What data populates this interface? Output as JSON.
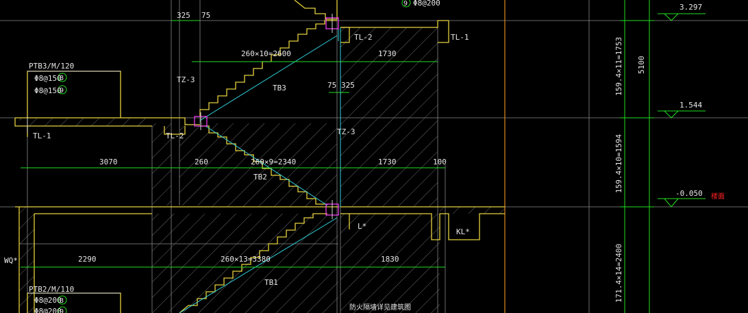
{
  "labels": {
    "tl2_top": "TL-2",
    "tl1_top": "TL-1",
    "tl1_left": "TL-1",
    "tl2_mid": "TL-2",
    "tz3_left": "TZ-3",
    "tz3_mid": "TZ-3",
    "tb3": "TB3",
    "tb2": "TB2",
    "tb1": "TB1",
    "l_beam": "L*",
    "kl_beam": "KL*",
    "wq": "WQ*",
    "ptb3_title": "PTB3/M/120",
    "ptb3_rebar1": "Φ8@150",
    "ptb3_rebar1_tag": "8",
    "ptb3_rebar2": "Φ8@150",
    "ptb3_rebar2_tag": "9",
    "ptb2_title": "PTB2/M/110",
    "ptb2_rebar1": "Φ8@200",
    "ptb2_rebar1_tag": "8",
    "ptb2_rebar2": "Φ8@200",
    "ptb2_rebar2_tag": "9",
    "top_rebar": "Φ8@200",
    "top_rebar_tag": "9",
    "bottom_note": "防火隔墙详见建筑图"
  },
  "dimensions": {
    "d325_top": "325",
    "d75_top": "75",
    "run_tb3": "260×10=2600",
    "land_1730_top": "1730",
    "d75_mid": "75",
    "d325_mid": "325",
    "d3070": "3070",
    "d260": "260",
    "run_tb2": "260×9=2340",
    "land_1730_mid": "1730",
    "d100": "100",
    "d2290": "2290",
    "run_tb1": "260×13=3380",
    "land_1830": "1830",
    "rise_upper": "159.4×11=1753",
    "rise_mid": "159.4×10=1594",
    "rise_lower": "171.4×14=2400",
    "total_height": "5100"
  },
  "elevations": {
    "e1": "3.297",
    "e2": "1.544",
    "e3": "-0.050",
    "e3_note": "楼面"
  }
}
